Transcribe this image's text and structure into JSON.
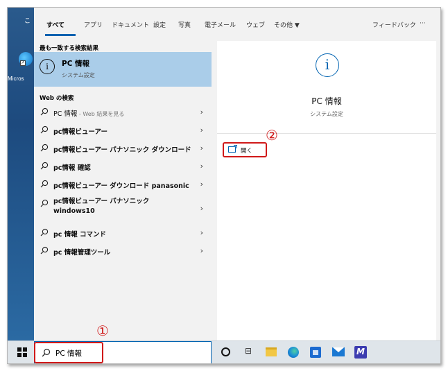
{
  "desktop": {
    "icon_label": "Micros",
    "top_fragment": "こ"
  },
  "tabs": [
    {
      "label": "すべて",
      "active": true
    },
    {
      "label": "アプリ"
    },
    {
      "label": "ドキュメント"
    },
    {
      "label": "設定"
    },
    {
      "label": "写真"
    },
    {
      "label": "電子メール"
    },
    {
      "label": "ウェブ"
    },
    {
      "label": "その他 ▼"
    }
  ],
  "feedback_label": "フィードバック",
  "more_label": "···",
  "best_match": {
    "section_title": "最も一致する検索結果",
    "title": "PC 情報",
    "subtitle": "システム設定"
  },
  "web_section_title": "Web の検索",
  "web_results": [
    {
      "text": "PC 情報",
      "suffix": " - Web 結果を見る"
    },
    {
      "text": "pc情報ビューアー",
      "suffix": ""
    },
    {
      "text": "pc情報ビューアー パナソニック ダウンロード",
      "suffix": ""
    },
    {
      "text": "pc情報 確認",
      "suffix": ""
    },
    {
      "text": "pc情報ビューアー ダウンロード panasonic",
      "suffix": ""
    },
    {
      "text": "pc情報ビューアー パナソニック windows10",
      "suffix": ""
    },
    {
      "text": "pc 情報 コマンド",
      "suffix": ""
    },
    {
      "text": "pc 情報管理ツール",
      "suffix": ""
    }
  ],
  "detail": {
    "title": "PC 情報",
    "subtitle": "システム設定",
    "open_label": "開く"
  },
  "callouts": {
    "one": "①",
    "two": "②"
  },
  "search": {
    "value": "PC 情報"
  },
  "colors": {
    "accent": "#0063b1",
    "highlight": "#aacde9",
    "annotation": "#d01919"
  }
}
